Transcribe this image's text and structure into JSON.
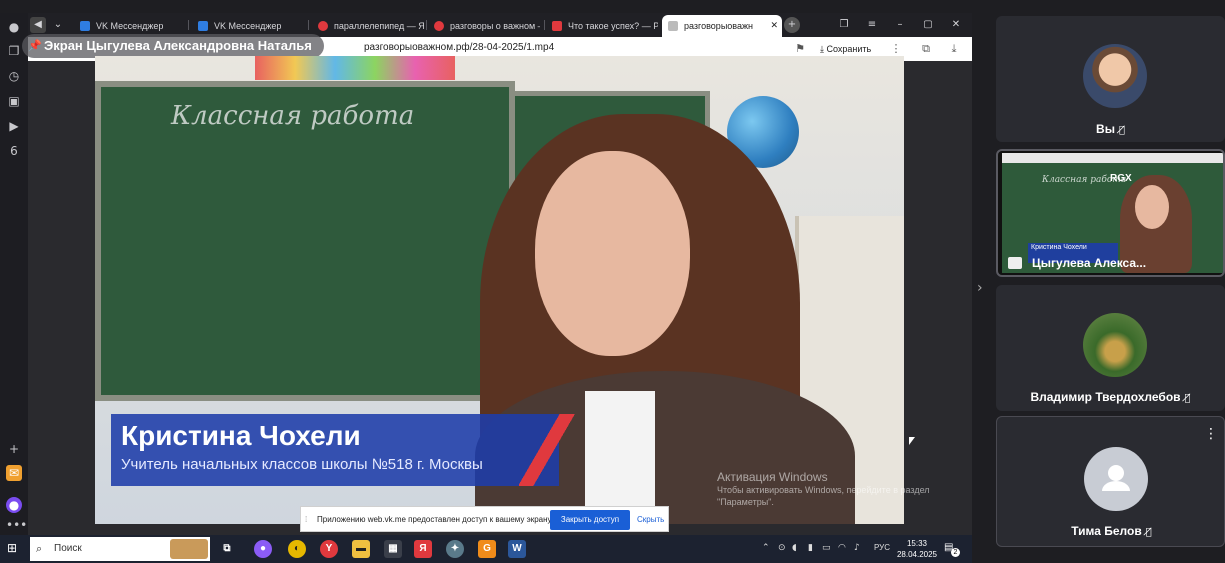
{
  "browser": {
    "tabs": [
      {
        "label": "VK Мессенджер",
        "fav_color": "#2f7de1"
      },
      {
        "label": "VK Мессенджер",
        "fav_color": "#2f7de1"
      },
      {
        "label": "параллелепипед — Янд",
        "fav_color": "#e0393e"
      },
      {
        "label": "разговоры о важном —",
        "fav_color": "#e0393e"
      },
      {
        "label": "Что такое успех? — Раз",
        "fav_color": "#e0393e"
      },
      {
        "label": "разговорыоважн",
        "fav_color": "#888888"
      }
    ],
    "url": "разговорыоважном.рф/28-04-2025/1.mp4",
    "save_label": "Сохранить"
  },
  "screen_share": {
    "label": "Экран Цыгулева Александровна Наталья"
  },
  "video": {
    "board_text": "Классная работа",
    "caption_name": "Кристина Чохели",
    "caption_title": "Учитель начальных классов школы №518 г. Москвы"
  },
  "windows_activation": {
    "title": "Активация Windows",
    "subtitle": "Чтобы активировать Windows, перейдите в раздел \"Параметры\"."
  },
  "share_notice": {
    "text": "Приложению web.vk.me предоставлен доступ к вашему экрану.",
    "stop_label": "Закрыть доступ",
    "hide_label": "Скрыть"
  },
  "taskbar": {
    "search_label": "Поиск",
    "language": "РУС",
    "time": "15:33",
    "date": "28.04.2025",
    "notification_count": "2"
  },
  "participants": [
    {
      "name": "Вы",
      "muted": true
    },
    {
      "name": "Цыгулева Алекса...",
      "muted": false,
      "mini_caption": "Кристина Чохели",
      "mini_label": "RGX"
    },
    {
      "name": "Владимир Твердохлебов",
      "muted": true
    },
    {
      "name": "Тима Белов",
      "muted": true
    }
  ],
  "colors": {
    "accent_blue": "#1a5fd6",
    "caption_blue": "#1e3caa",
    "caption_red": "#e0393e"
  }
}
